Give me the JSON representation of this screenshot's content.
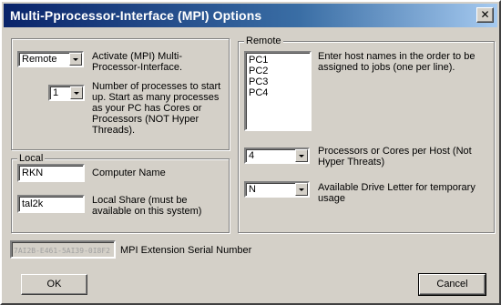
{
  "window": {
    "title": "Multi-Pprocessor-Interface (MPI) Options",
    "close_symbol": "✕"
  },
  "activate": {
    "value": "Remote",
    "label": "Activate (MPI) Multi-Processor-Interface."
  },
  "processes": {
    "value": "1",
    "label": "Number of processes to start up. Start as many processes as your PC has Cores or Processors (NOT Hyper Threads)."
  },
  "local": {
    "group_label": "Local",
    "computer_name_value": "RKN",
    "computer_name_label": "Computer Name",
    "local_share_value": "tal2k",
    "local_share_label": "Local Share (must be available on this system)"
  },
  "remote": {
    "group_label": "Remote",
    "hosts": [
      "PC1",
      "PC2",
      "PC3",
      "PC4"
    ],
    "hosts_label": "Enter host names in the order to be assigned to jobs (one per line).",
    "cores_value": "4",
    "cores_label": "Processors or Cores per Host (Not Hyper Threats)",
    "drive_value": "N",
    "drive_label": "Available Drive Letter for temporary usage"
  },
  "serial": {
    "value": "7AI2B-E461-5AI39-0I8F2",
    "label": "MPI Extension Serial Number"
  },
  "buttons": {
    "ok": "OK",
    "cancel": "Cancel"
  }
}
